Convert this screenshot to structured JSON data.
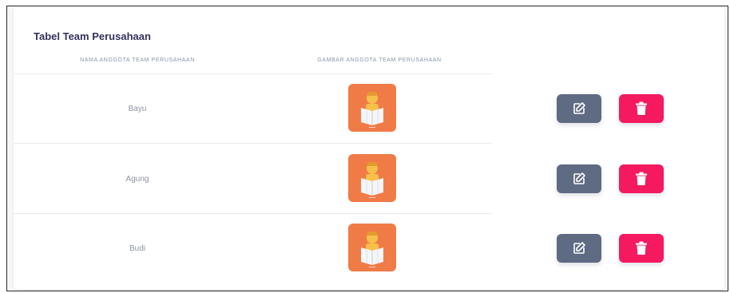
{
  "table": {
    "title": "Tabel Team Perusahaan",
    "columns": [
      "NAMA ANGGOTA TEAM PERUSAHAAN",
      "GAMBAR ANGGOTA TEAM PERUSAHAAN"
    ],
    "rows": [
      {
        "name": "Bayu",
        "image_icon": "person-reading-map-icon"
      },
      {
        "name": "Agung",
        "image_icon": "person-reading-map-icon"
      },
      {
        "name": "Budi",
        "image_icon": "person-reading-map-icon"
      }
    ],
    "actions": {
      "edit_icon": "edit-icon",
      "delete_icon": "trash-icon"
    }
  },
  "colors": {
    "edit_button": "#5f6b82",
    "delete_button": "#f5195f",
    "avatar_background": "#f07b47"
  }
}
